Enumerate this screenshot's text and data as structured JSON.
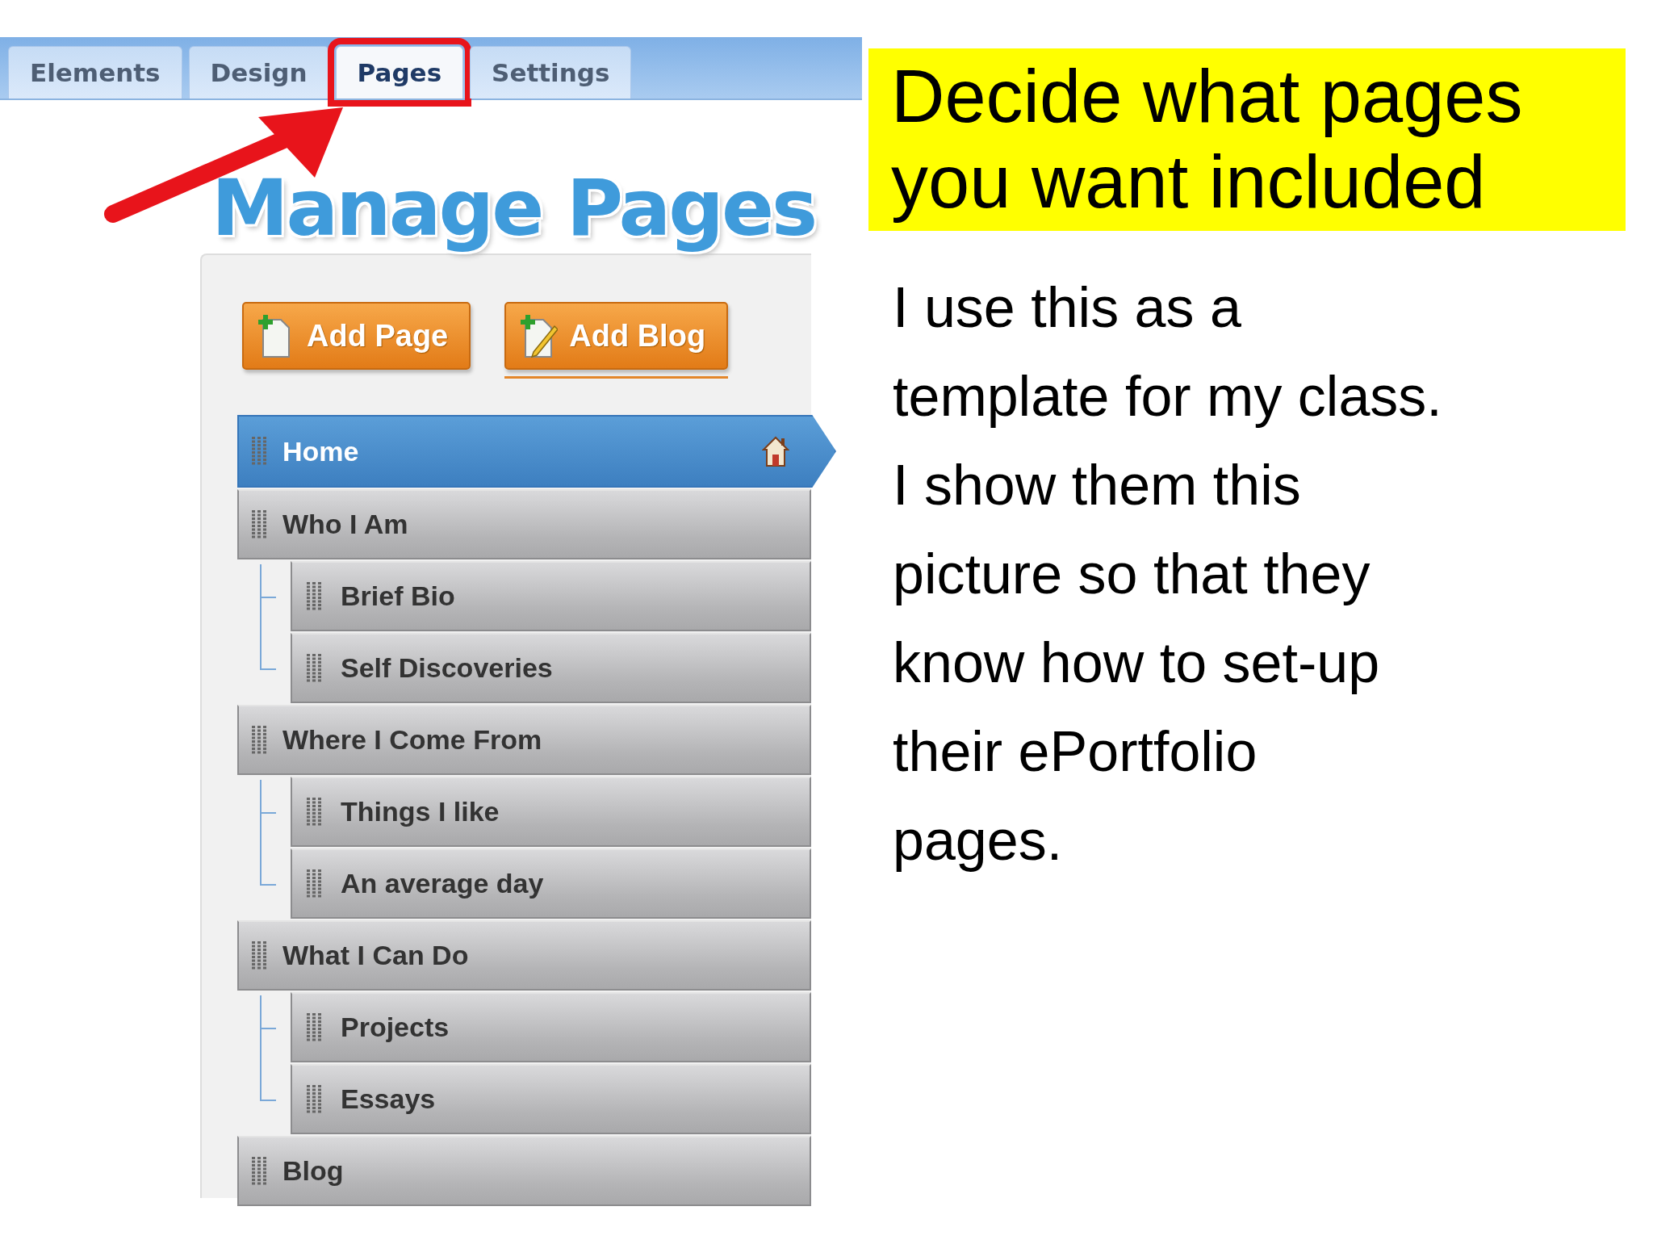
{
  "tabs": [
    {
      "label": "Elements",
      "selected": false,
      "callout": false
    },
    {
      "label": "Design",
      "selected": false,
      "callout": false
    },
    {
      "label": "Pages",
      "selected": true,
      "callout": true
    },
    {
      "label": "Settings",
      "selected": false,
      "callout": false
    }
  ],
  "title": "Manage Pages",
  "buttons": [
    {
      "label": "Add Page",
      "kind": "page",
      "underlined": false
    },
    {
      "label": "Add Blog",
      "kind": "blog",
      "underlined": true
    }
  ],
  "pages": [
    {
      "label": "Home",
      "selected": true,
      "home": true
    },
    {
      "label": "Who I Am",
      "selected": false,
      "home": false,
      "children": [
        {
          "label": "Brief Bio",
          "selected": false
        },
        {
          "label": "Self Discoveries",
          "selected": false
        }
      ]
    },
    {
      "label": "Where I Come From",
      "selected": false,
      "home": false,
      "children": [
        {
          "label": "Things I like",
          "selected": false
        },
        {
          "label": "An average day",
          "selected": false
        }
      ]
    },
    {
      "label": "What I Can Do",
      "selected": false,
      "home": false,
      "children": [
        {
          "label": "Projects",
          "selected": false
        },
        {
          "label": "Essays",
          "selected": false
        }
      ]
    },
    {
      "label": "Blog",
      "selected": false,
      "home": false
    }
  ],
  "heading_lines": [
    "Decide what pages",
    "you want included"
  ],
  "body_lines": [
    "I use this as a",
    "template for my class.",
    "I show them this",
    "picture so that they",
    "know how to set-up",
    "their ePortfolio",
    "pages."
  ]
}
